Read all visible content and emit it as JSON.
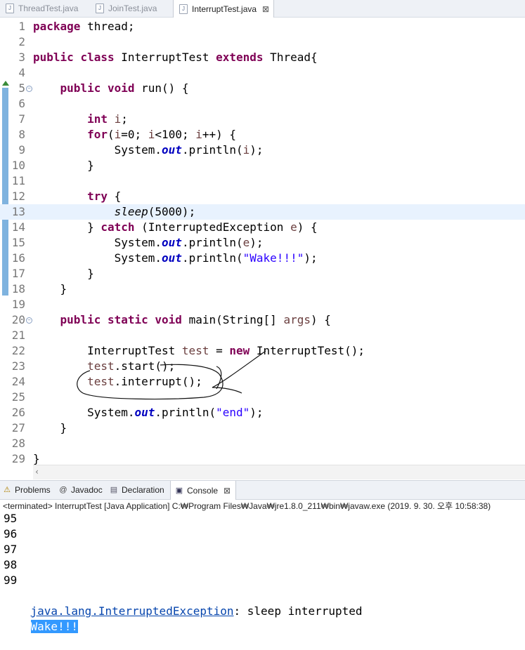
{
  "editor_tabs": [
    {
      "label": "ThreadTest.java",
      "active": false
    },
    {
      "label": "JoinTest.java",
      "active": false
    },
    {
      "label": "InterruptTest.java",
      "active": true,
      "close": "⊠"
    }
  ],
  "code_lines": [
    {
      "n": "1",
      "parts": [
        {
          "c": "kw",
          "t": "package"
        },
        {
          "t": " thread;"
        }
      ]
    },
    {
      "n": "2",
      "parts": []
    },
    {
      "n": "3",
      "parts": [
        {
          "c": "kw",
          "t": "public"
        },
        {
          "t": " "
        },
        {
          "c": "kw",
          "t": "class"
        },
        {
          "t": " InterruptTest "
        },
        {
          "c": "kw",
          "t": "extends"
        },
        {
          "t": " Thread{"
        }
      ]
    },
    {
      "n": "4",
      "parts": []
    },
    {
      "n": "5",
      "fold": true,
      "parts": [
        {
          "t": "    "
        },
        {
          "c": "kw",
          "t": "public"
        },
        {
          "t": " "
        },
        {
          "c": "kw",
          "t": "void"
        },
        {
          "t": " run() {"
        }
      ]
    },
    {
      "n": "6",
      "parts": []
    },
    {
      "n": "7",
      "parts": [
        {
          "t": "        "
        },
        {
          "c": "kw",
          "t": "int"
        },
        {
          "t": " "
        },
        {
          "c": "var",
          "t": "i"
        },
        {
          "t": ";"
        }
      ]
    },
    {
      "n": "8",
      "parts": [
        {
          "t": "        "
        },
        {
          "c": "kw",
          "t": "for"
        },
        {
          "t": "("
        },
        {
          "c": "var",
          "t": "i"
        },
        {
          "t": "=0; "
        },
        {
          "c": "var",
          "t": "i"
        },
        {
          "t": "<100; "
        },
        {
          "c": "var",
          "t": "i"
        },
        {
          "t": "++) {"
        }
      ]
    },
    {
      "n": "9",
      "parts": [
        {
          "t": "            System."
        },
        {
          "c": "fld",
          "t": "out"
        },
        {
          "t": ".println("
        },
        {
          "c": "var",
          "t": "i"
        },
        {
          "t": ");"
        }
      ]
    },
    {
      "n": "10",
      "parts": [
        {
          "t": "        }"
        }
      ]
    },
    {
      "n": "11",
      "parts": []
    },
    {
      "n": "12",
      "parts": [
        {
          "t": "        "
        },
        {
          "c": "kw",
          "t": "try"
        },
        {
          "t": " {"
        }
      ]
    },
    {
      "n": "13",
      "current": true,
      "parts": [
        {
          "t": "            "
        },
        {
          "c": "stat",
          "t": "sleep"
        },
        {
          "t": "(5000);"
        }
      ]
    },
    {
      "n": "14",
      "parts": [
        {
          "t": "        } "
        },
        {
          "c": "kw",
          "t": "catch"
        },
        {
          "t": " (InterruptedException "
        },
        {
          "c": "var",
          "t": "e"
        },
        {
          "t": ") {"
        }
      ]
    },
    {
      "n": "15",
      "parts": [
        {
          "t": "            System."
        },
        {
          "c": "fld",
          "t": "out"
        },
        {
          "t": ".println("
        },
        {
          "c": "var",
          "t": "e"
        },
        {
          "t": ");"
        }
      ]
    },
    {
      "n": "16",
      "parts": [
        {
          "t": "            System."
        },
        {
          "c": "fld",
          "t": "out"
        },
        {
          "t": ".println("
        },
        {
          "c": "str",
          "t": "\"Wake!!!\""
        },
        {
          "t": ");"
        }
      ]
    },
    {
      "n": "17",
      "parts": [
        {
          "t": "        }"
        }
      ]
    },
    {
      "n": "18",
      "parts": [
        {
          "t": "    }"
        }
      ]
    },
    {
      "n": "19",
      "parts": []
    },
    {
      "n": "20",
      "fold": true,
      "parts": [
        {
          "t": "    "
        },
        {
          "c": "kw",
          "t": "public"
        },
        {
          "t": " "
        },
        {
          "c": "kw",
          "t": "static"
        },
        {
          "t": " "
        },
        {
          "c": "kw",
          "t": "void"
        },
        {
          "t": " main(String[] "
        },
        {
          "c": "var",
          "t": "args"
        },
        {
          "t": ") {"
        }
      ]
    },
    {
      "n": "21",
      "parts": []
    },
    {
      "n": "22",
      "parts": [
        {
          "t": "        InterruptTest "
        },
        {
          "c": "var",
          "t": "test"
        },
        {
          "t": " = "
        },
        {
          "c": "kw",
          "t": "new"
        },
        {
          "t": " InterruptTest();"
        }
      ]
    },
    {
      "n": "23",
      "parts": [
        {
          "t": "        "
        },
        {
          "c": "var",
          "t": "test"
        },
        {
          "t": ".start();"
        }
      ]
    },
    {
      "n": "24",
      "parts": [
        {
          "t": "        "
        },
        {
          "c": "var",
          "t": "test"
        },
        {
          "t": ".interrupt();"
        }
      ]
    },
    {
      "n": "25",
      "parts": []
    },
    {
      "n": "26",
      "parts": [
        {
          "t": "        System."
        },
        {
          "c": "fld",
          "t": "out"
        },
        {
          "t": ".println("
        },
        {
          "c": "str",
          "t": "\"end\""
        },
        {
          "t": ");"
        }
      ]
    },
    {
      "n": "27",
      "parts": [
        {
          "t": "    }"
        }
      ]
    },
    {
      "n": "28",
      "parts": []
    },
    {
      "n": "29",
      "parts": [
        {
          "t": "}"
        }
      ]
    }
  ],
  "panel_tabs": [
    {
      "label": "Problems",
      "icon": "problems-icon",
      "glyph": "⚠",
      "active": false
    },
    {
      "label": "Javadoc",
      "icon": "javadoc-icon",
      "glyph": "@",
      "active": false
    },
    {
      "label": "Declaration",
      "icon": "declaration-icon",
      "glyph": "▤",
      "active": false
    },
    {
      "label": "Console",
      "icon": "console-icon",
      "glyph": "▣",
      "active": true,
      "close": "⊠"
    }
  ],
  "console": {
    "status": "<terminated> InterruptTest [Java Application] C:₩Program Files₩Java₩jre1.8.0_211₩bin₩javaw.exe (2019. 9. 30. 오후 10:58:38)",
    "lines": [
      "95",
      "96",
      "97",
      "98",
      "99"
    ],
    "exception_class": "java.lang.InterruptedException",
    "exception_msg": ": sleep interrupted",
    "selected_line": "Wake!!!"
  },
  "colors": {
    "keyword": "#7f0055",
    "variable": "#6a3e3e",
    "field": "#0000c0",
    "string": "#2a00ff",
    "current_line": "#e8f2fe",
    "selection": "#3399ff"
  }
}
